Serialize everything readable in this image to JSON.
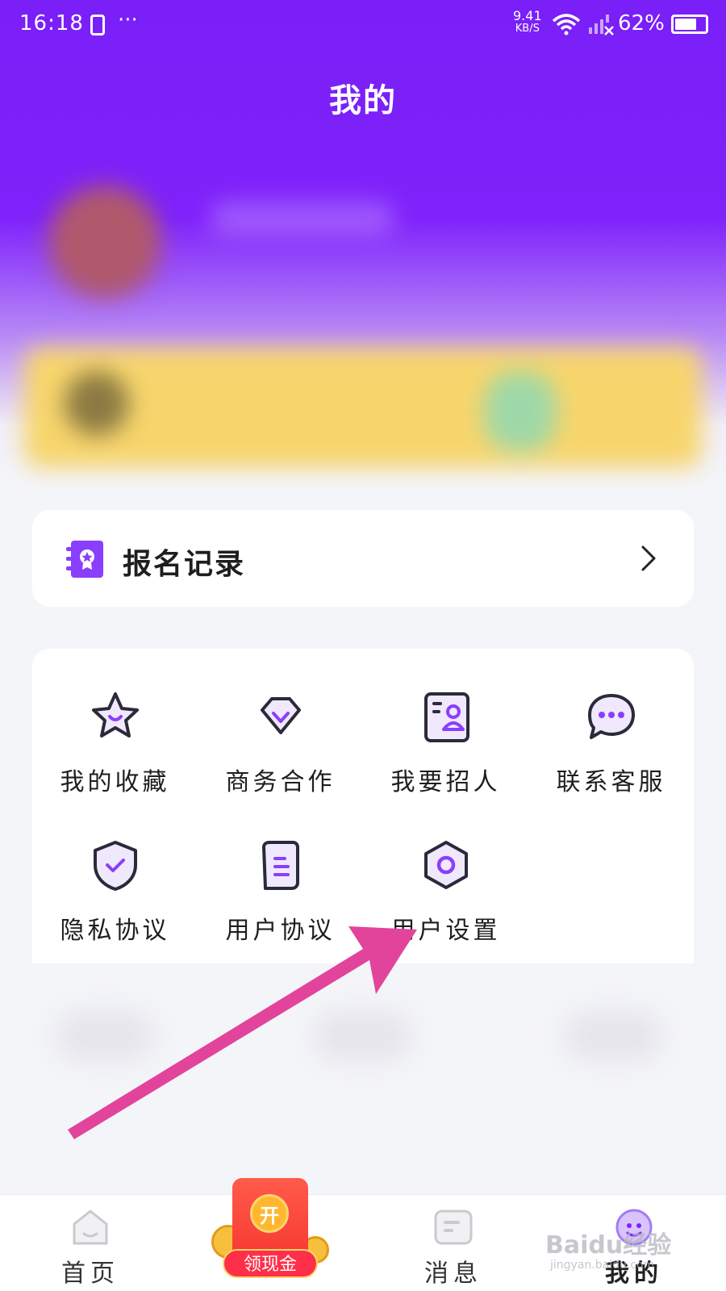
{
  "status_bar": {
    "time": "16:18",
    "dots": "···",
    "net_speed_value": "9.41",
    "net_speed_unit": "KB/S",
    "battery": "62%"
  },
  "header": {
    "title": "我的"
  },
  "signup_record": {
    "label": "报名记录",
    "icon": "certificate-book-icon",
    "arrow": "chevron-right-icon"
  },
  "grid": {
    "items": [
      {
        "label": "我的收藏",
        "icon": "star-icon"
      },
      {
        "label": "商务合作",
        "icon": "diamond-icon"
      },
      {
        "label": "我要招人",
        "icon": "resume-card-icon"
      },
      {
        "label": "联系客服",
        "icon": "chat-bubble-icon"
      },
      {
        "label": "隐私协议",
        "icon": "shield-check-icon"
      },
      {
        "label": "用户协议",
        "icon": "document-icon"
      },
      {
        "label": "用户设置",
        "icon": "settings-hexagon-icon"
      }
    ]
  },
  "bottom_nav": {
    "items": [
      {
        "label": "首页",
        "icon": "home-icon"
      },
      {
        "label": "消息",
        "icon": "message-icon"
      },
      {
        "label": "我的",
        "icon": "profile-face-icon",
        "active": true
      }
    ],
    "cash": {
      "open": "开",
      "label": "领现金"
    }
  },
  "watermark": {
    "text": "Baidu经验",
    "sub": "jingyan.baidu.com"
  },
  "colors": {
    "primary": "#7f22fb",
    "accent_purple": "#8a3ffc",
    "arrow_pink": "#e2449b",
    "card_bg": "#ffffff",
    "page_bg": "#f4f5f9"
  }
}
